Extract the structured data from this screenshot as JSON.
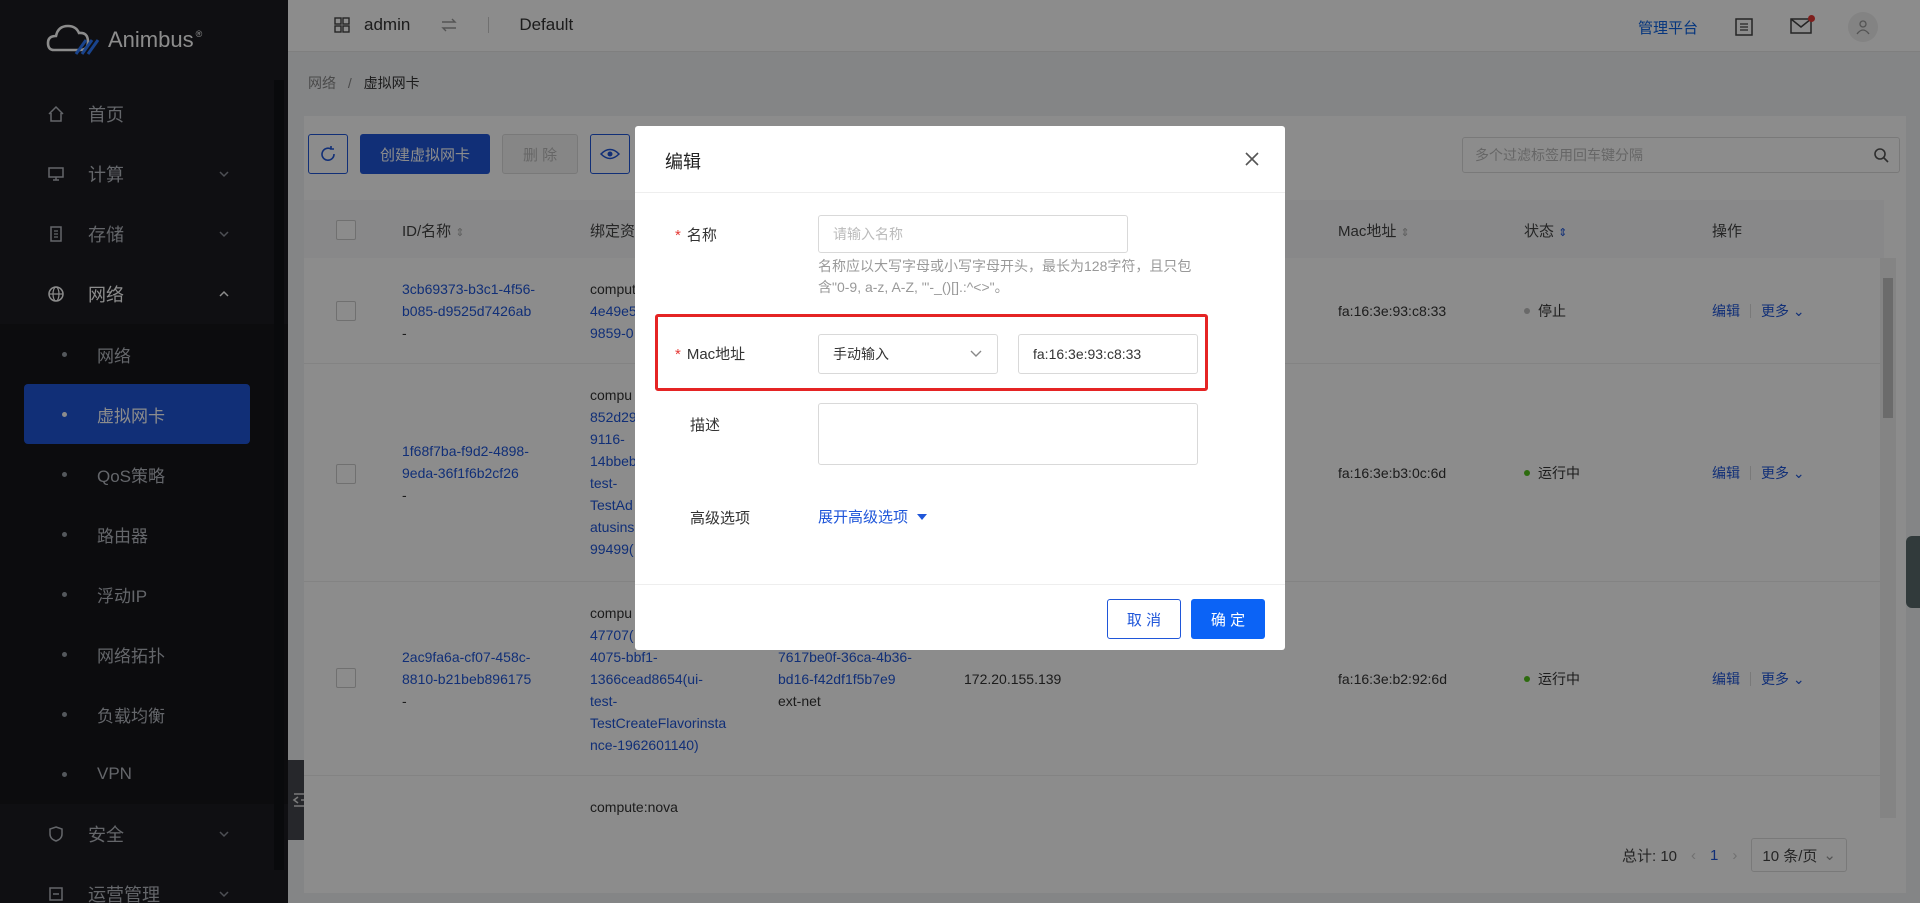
{
  "app": {
    "brand": "Animbus"
  },
  "header": {
    "user": "admin",
    "project": "Default",
    "admin_link": "管理平台"
  },
  "sidebar": {
    "items": [
      {
        "label": "首页",
        "icon": "home-icon"
      },
      {
        "label": "计算",
        "icon": "monitor-icon"
      },
      {
        "label": "存储",
        "icon": "storage-icon"
      },
      {
        "label": "网络",
        "icon": "globe-icon"
      }
    ],
    "network_sub": [
      {
        "label": "网络"
      },
      {
        "label": "虚拟网卡"
      },
      {
        "label": "QoS策略"
      },
      {
        "label": "路由器"
      },
      {
        "label": "浮动IP"
      },
      {
        "label": "网络拓扑"
      },
      {
        "label": "负载均衡"
      },
      {
        "label": "VPN"
      }
    ],
    "bottom_items": [
      {
        "label": "安全",
        "icon": "shield-icon"
      },
      {
        "label": "运营管理",
        "icon": "ops-icon"
      }
    ]
  },
  "breadcrumb": {
    "parent": "网络",
    "sep": "/",
    "current": "虚拟网卡"
  },
  "toolbar": {
    "create_label": "创建虚拟网卡",
    "delete_label": "删 除",
    "search_placeholder": "多个过滤标签用回车键分隔"
  },
  "table": {
    "headers": {
      "id_name": "ID/名称",
      "bound": "绑定资",
      "mac": "Mac地址",
      "status": "状态",
      "ops": "操作"
    },
    "rows": [
      {
        "id_line1": "3cb69373-b3c1-4f56-",
        "id_line2": "b085-d9525d7426ab",
        "name": "-",
        "bound": [
          "compute",
          "4e49e5",
          "9859-0"
        ],
        "mac": "fa:16:3e:93:c8:33",
        "status": "停止",
        "status_color": "#bfbfbf"
      },
      {
        "id_line1": "1f68f7ba-f9d2-4898-",
        "id_line2": "9eda-36f1f6b2cf26",
        "name": "-",
        "bound": [
          "compu",
          "852d29",
          "9116-",
          "14bbeb",
          "test-",
          "TestAd",
          "atusins",
          "99499("
        ],
        "mac": "fa:16:3e:b3:0c:6d",
        "status": "运行中",
        "status_color": "#52c41a"
      },
      {
        "id_line1": "2ac9fa6a-cf07-458c-",
        "id_line2": "8810-b21beb896175",
        "name": "-",
        "bound": [
          "compu",
          "47707(",
          "4075-bbf1-",
          "1366cead8654(ui-",
          "test-",
          "TestCreateFlavorinsta",
          "nce-1962601140)"
        ],
        "net_line1": "7617be0f-36ca-4b36-",
        "net_line2": "bd16-f42df1f5b7e9",
        "net_name": "ext-net",
        "ip": "172.20.155.139",
        "mac": "fa:16:3e:b2:92:6d",
        "status": "运行中",
        "status_color": "#52c41a"
      },
      {
        "bound": [
          "compute:nova"
        ]
      }
    ],
    "op_edit": "编辑",
    "op_more": "更多"
  },
  "pager": {
    "total": "总计: 10",
    "page": "1",
    "size": "10 条/页"
  },
  "dialog": {
    "title": "编辑",
    "name_label": "名称",
    "name_placeholder": "请输入名称",
    "name_help": "名称应以大写字母或小写字母开头，最长为128字符，且只包含\"0-9, a-z, A-Z, \"'-_()[].:^<>\"。",
    "mac_label": "Mac地址",
    "mac_mode": "手动输入",
    "mac_value": "fa:16:3e:93:c8:33",
    "desc_label": "描述",
    "adv_label": "高级选项",
    "adv_toggle": "展开高级选项",
    "cancel": "取 消",
    "ok": "确 定"
  },
  "colors": {
    "primary": "#1f56d9",
    "sidebar_bg": "#1c1d22",
    "highlight": "#e52424"
  }
}
